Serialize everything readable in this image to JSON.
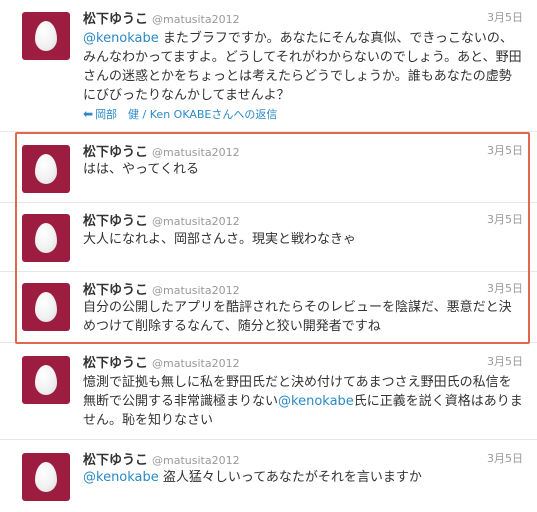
{
  "tweets": [
    {
      "name": "松下ゆうこ",
      "handle": "@matusita2012",
      "date": "3月5日",
      "mention": "@kenokabe",
      "text": " またブラフですか。あなたにそんな真似、できっこないの、みんなわかってますよ。どうしてそれがわからないのでしょう。あと、野田さんの迷惑とかをちょっとは考えたらどうでしょうか。誰もあなたの虚勢にびびったりなんかしてませんよ？",
      "reply_to": "岡部　健 / Ken OKABEさんへの返信"
    },
    {
      "name": "松下ゆうこ",
      "handle": "@matusita2012",
      "date": "3月5日",
      "text": "はは、やってくれる"
    },
    {
      "name": "松下ゆうこ",
      "handle": "@matusita2012",
      "date": "3月5日",
      "text": "大人になれよ、岡部さんさ。現実と戦わなきゃ"
    },
    {
      "name": "松下ゆうこ",
      "handle": "@matusita2012",
      "date": "3月5日",
      "text": "自分の公開したアプリを酷評されたらそのレビューを陰謀だ、悪意だと決めつけて削除するなんて、随分と狡い開発者ですね"
    },
    {
      "name": "松下ゆうこ",
      "handle": "@matusita2012",
      "date": "3月5日",
      "text_before": "憶測で証拠も無しに私を野田氏だと決め付けてあまつさえ野田氏の私信を無断で公開する非常識極まりない",
      "mention": "@kenokabe",
      "text_after": "氏に正義を説く資格はありません。恥を知りなさい"
    },
    {
      "name": "松下ゆうこ",
      "handle": "@matusita2012",
      "date": "3月5日",
      "mention": "@kenokabe",
      "text": " 盗人猛々しいってあなたがそれを言いますか"
    }
  ],
  "colors": {
    "avatar": "#9d1d40",
    "link": "#2b8ac6",
    "highlight_border": "#e0684c"
  },
  "icons": {
    "reply": "reply-arrow-icon",
    "avatar": "default-egg-avatar-icon"
  }
}
